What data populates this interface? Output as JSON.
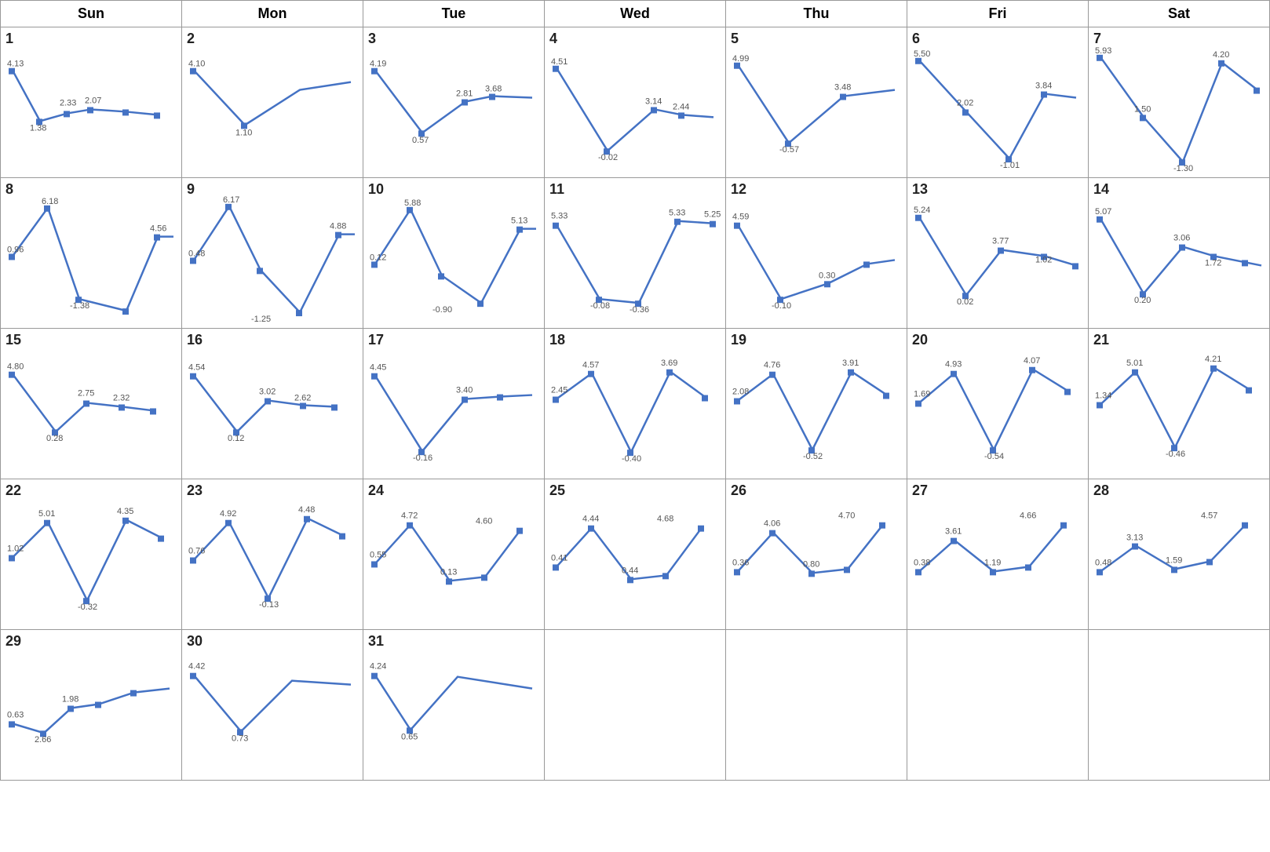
{
  "headers": [
    "Sun",
    "Mon",
    "Tue",
    "Wed",
    "Thu",
    "Fri",
    "Sat"
  ],
  "days": [
    {
      "day": 1,
      "col": 0,
      "values": [
        4.13,
        1.38,
        2.33,
        2.07
      ],
      "points_norm": [
        0.05,
        0.65,
        0.35,
        0.48,
        0.42
      ]
    },
    {
      "day": 2,
      "col": 1,
      "values": [
        4.1,
        1.1
      ],
      "points_norm": [
        0.05,
        0.5,
        0.75,
        0.5
      ]
    },
    {
      "day": 3,
      "col": 2,
      "values": [
        4.19,
        0.57,
        2.81,
        3.68
      ]
    },
    {
      "day": 4,
      "col": 3,
      "values": [
        4.51,
        -0.02,
        3.14,
        2.44
      ]
    },
    {
      "day": 5,
      "col": 4,
      "values": [
        4.99,
        -0.57,
        3.48
      ]
    },
    {
      "day": 6,
      "col": 5,
      "values": [
        5.5,
        2.02,
        3.84,
        -1.01
      ]
    },
    {
      "day": 7,
      "col": 6,
      "values": [
        5.93,
        1.5,
        -1.3,
        4.2
      ]
    },
    {
      "day": 8,
      "col": 0,
      "values": [
        6.18,
        0.96,
        -1.38,
        4.56
      ]
    },
    {
      "day": 9,
      "col": 1,
      "values": [
        6.17,
        0.48,
        -1.25,
        4.88
      ]
    },
    {
      "day": 10,
      "col": 2,
      "values": [
        5.88,
        0.12,
        -0.9,
        5.13
      ]
    },
    {
      "day": 11,
      "col": 3,
      "values": [
        5.33,
        -0.08,
        -0.36,
        5.25
      ]
    },
    {
      "day": 12,
      "col": 4,
      "values": [
        4.59,
        -0.1,
        0.3
      ]
    },
    {
      "day": 13,
      "col": 5,
      "values": [
        5.24,
        0.02,
        3.77,
        1.02
      ]
    },
    {
      "day": 14,
      "col": 6,
      "values": [
        5.07,
        0.2,
        3.06,
        1.72
      ]
    },
    {
      "day": 15,
      "col": 0,
      "values": [
        4.8,
        0.28,
        2.75,
        2.32
      ]
    },
    {
      "day": 16,
      "col": 1,
      "values": [
        4.54,
        0.12,
        3.02,
        2.62
      ]
    },
    {
      "day": 17,
      "col": 2,
      "values": [
        4.45,
        -0.16,
        3.4
      ]
    },
    {
      "day": 18,
      "col": 3,
      "values": [
        4.57,
        2.45,
        -0.4,
        3.69
      ]
    },
    {
      "day": 19,
      "col": 4,
      "values": [
        4.76,
        2.08,
        -0.52,
        3.91
      ]
    },
    {
      "day": 20,
      "col": 5,
      "values": [
        4.93,
        1.69,
        -0.54,
        4.07
      ]
    },
    {
      "day": 21,
      "col": 6,
      "values": [
        5.01,
        1.34,
        -0.46,
        4.21
      ]
    },
    {
      "day": 22,
      "col": 0,
      "values": [
        5.01,
        1.02,
        -0.32,
        4.35
      ]
    },
    {
      "day": 23,
      "col": 1,
      "values": [
        4.92,
        0.76,
        -0.13,
        4.48
      ]
    },
    {
      "day": 24,
      "col": 2,
      "values": [
        4.72,
        0.55,
        0.13,
        4.6
      ]
    },
    {
      "day": 25,
      "col": 3,
      "values": [
        4.44,
        0.41,
        0.44,
        4.68
      ]
    },
    {
      "day": 26,
      "col": 4,
      "values": [
        4.06,
        0.36,
        0.8,
        4.7
      ]
    },
    {
      "day": 27,
      "col": 5,
      "values": [
        3.61,
        0.38,
        1.19,
        4.66
      ]
    },
    {
      "day": 28,
      "col": 6,
      "values": [
        3.13,
        0.48,
        1.59,
        4.57
      ]
    },
    {
      "day": 29,
      "col": 0,
      "values": [
        2.66,
        0.63,
        1.98
      ]
    },
    {
      "day": 30,
      "col": 1,
      "values": [
        4.42,
        0.73
      ]
    },
    {
      "day": 31,
      "col": 2,
      "values": [
        4.24,
        0.65
      ]
    }
  ]
}
